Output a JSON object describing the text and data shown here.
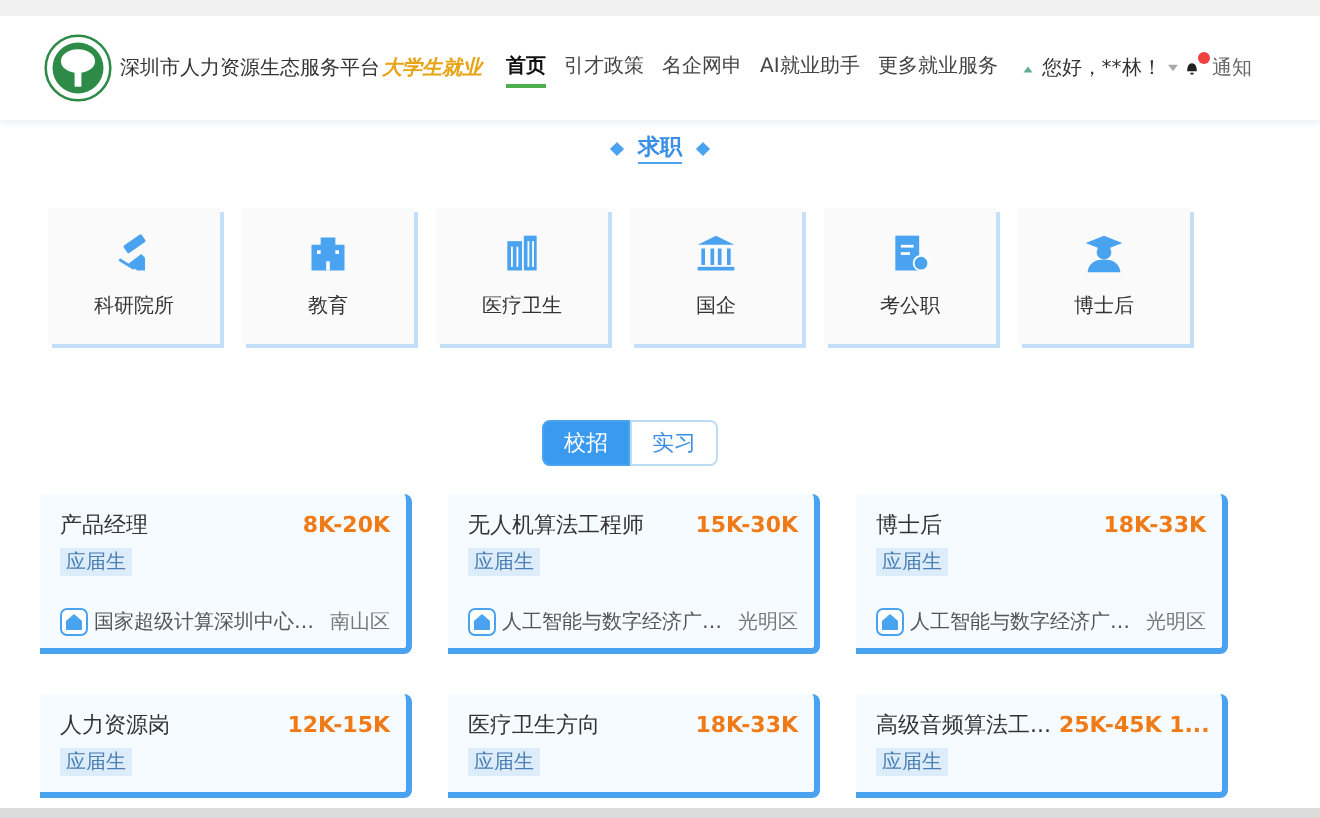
{
  "header": {
    "site_name": "深圳市人力资源生态服务平台",
    "site_badge": "大学生就业",
    "nav": [
      {
        "label": "首页",
        "selected": true
      },
      {
        "label": "引才政策",
        "selected": false
      },
      {
        "label": "名企网申",
        "selected": false
      },
      {
        "label": "AI就业助手",
        "selected": false
      },
      {
        "label": "更多就业服务",
        "selected": false
      }
    ],
    "greeting": "您好，**林！",
    "notify_label": "通知"
  },
  "section_title": "求职",
  "categories": [
    {
      "label": "科研院所",
      "kind": "microscope"
    },
    {
      "label": "教育",
      "kind": "school"
    },
    {
      "label": "医疗卫生",
      "kind": "building"
    },
    {
      "label": "国企",
      "kind": "bank"
    },
    {
      "label": "考公职",
      "kind": "exam"
    },
    {
      "label": "博士后",
      "kind": "graduate"
    }
  ],
  "job_tabs": [
    {
      "label": "校招",
      "selected": true
    },
    {
      "label": "实习",
      "selected": false
    }
  ],
  "jobs": [
    {
      "title": "产品经理",
      "salary": "8K-20K",
      "tag": "应届生",
      "company": "国家超级计算深圳中心…",
      "district": "南山区"
    },
    {
      "title": "无人机算法工程师",
      "salary": "15K-30K",
      "tag": "应届生",
      "company": "人工智能与数字经济广…",
      "district": "光明区"
    },
    {
      "title": "博士后",
      "salary": "18K-33K",
      "tag": "应届生",
      "company": "人工智能与数字经济广…",
      "district": "光明区"
    },
    {
      "title": "人力资源岗",
      "salary": "12K-15K",
      "tag": "应届生"
    },
    {
      "title": "医疗卫生方向",
      "salary": "18K-33K",
      "tag": "应届生"
    },
    {
      "title": "高级音频算法工...",
      "salary": "25K-45K 1...",
      "tag": "应届生"
    }
  ]
}
